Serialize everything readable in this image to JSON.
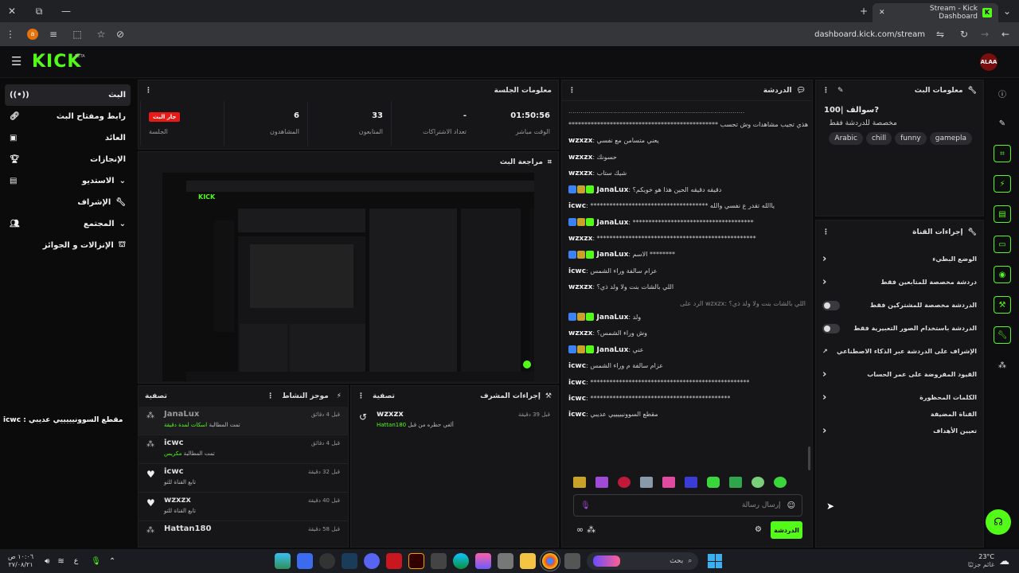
{
  "browser": {
    "tab_title": "Stream - Kick Dashboard",
    "url": "dashboard.kick.com/stream",
    "avatar_letter": "a"
  },
  "header": {
    "logo": "KICK",
    "logo_sup": "BETA",
    "user_initials": "ALAA"
  },
  "sidebar": {
    "items": [
      {
        "label": "البث",
        "icon": "broadcast-icon"
      },
      {
        "label": "رابط ومفتاح البث",
        "icon": "link-icon"
      },
      {
        "label": "العائد",
        "icon": "revenue-icon"
      },
      {
        "label": "الإنجازات",
        "icon": "trophy-icon"
      },
      {
        "label": "الاستديو",
        "icon": "studio-icon"
      },
      {
        "label": "الإشراف",
        "icon": "wrench-icon"
      },
      {
        "label": "المجتمع",
        "icon": "community-icon"
      },
      {
        "label": "الإنزالات و الجوائز",
        "icon": "drops-icon"
      }
    ]
  },
  "session": {
    "title": "معلومات الجلسة",
    "live_badge": "جار البث",
    "session_label": "الجلسة",
    "stats": [
      {
        "value": "6",
        "label": "المشاهدون"
      },
      {
        "value": "33",
        "label": "المتابعون"
      },
      {
        "value": "-",
        "label": "تعداد الاشتراكات"
      },
      {
        "value": "01:50:56",
        "label": "الوقت مباشر"
      }
    ]
  },
  "preview": {
    "title": "مراجعة البث",
    "overlay_caption": "icwc : مقطع السوونيييييي عديبي"
  },
  "activity": {
    "title": "موجز النشاط",
    "filter": "تصفية",
    "rows": [
      {
        "user": "JanaLux",
        "time": "قبل 4 دقائق",
        "text": "تمت المطالبة",
        "highlight": "اسكات لمدة دقيقة"
      },
      {
        "user": "icwc",
        "time": "قبل 4 دقائق",
        "text": "تمت المطالبة",
        "highlight": "مكريس"
      },
      {
        "user": "icwc",
        "time": "قبل 32 دقيقة",
        "text": "تابع القناة للتو",
        "highlight": ""
      },
      {
        "user": "wzxzx",
        "time": "قبل 40 دقيقة",
        "text": "تابع القناة للتو",
        "highlight": ""
      },
      {
        "user": "Hattan180",
        "time": "قبل 58 دقيقة",
        "text": "",
        "highlight": ""
      }
    ]
  },
  "mod": {
    "title": "إجراءات المشرف",
    "filter": "تصفية",
    "row": {
      "user": "wzxzx",
      "time": "قبل 39 دقيقة",
      "by": "Hattan180",
      "text": "ألغي حظره من قبل"
    }
  },
  "chat": {
    "title": "الدردشة",
    "messages": [
      {
        "user": "",
        "text": "*********************************************** هذي تجيب مشاهدات وش تحسب",
        "badges": 0
      },
      {
        "user": "wzxzx",
        "text": "يعني متسامن مع نفسي",
        "badges": 0
      },
      {
        "user": "wzxzx",
        "text": "حسونك",
        "badges": 0
      },
      {
        "user": "wzxzx",
        "text": "شيك ستاب",
        "badges": 0
      },
      {
        "user": "JanaLux",
        "text": "دقيقه دقيقه الحين هذا هو خويكم؟",
        "badges": 3
      },
      {
        "user": "icwc",
        "text": "************************************* ياالله تقدر ع نفسي والله",
        "badges": 0
      },
      {
        "user": "JanaLux",
        "text": "**************************************",
        "badges": 3
      },
      {
        "user": "wzxzx",
        "text": "**************************************************",
        "badges": 0
      },
      {
        "user": "JanaLux",
        "text": "الاسم ********",
        "badges": 3
      },
      {
        "user": "icwc",
        "text": "عزام سالفة وراء الشمس",
        "badges": 0
      },
      {
        "user": "wzxzx",
        "text": "اللي بالشات بنت ولا ولد ذي؟",
        "badges": 0
      },
      {
        "user": "JanaLux",
        "text": "ولد",
        "badges": 3
      },
      {
        "user": "wzxzx",
        "text": "وش وراء الشمس؟",
        "badges": 0
      },
      {
        "user": "JanaLux",
        "text": "عني",
        "badges": 3
      },
      {
        "user": "icwc",
        "text": "عزام سالفة م وراء الشمس",
        "badges": 0
      },
      {
        "user": "icwc",
        "text": "**************************************************",
        "badges": 0
      },
      {
        "user": "icwc",
        "text": "********************************************",
        "badges": 0
      },
      {
        "user": "icwc",
        "text": "مقطع السوونيييييي عديبي",
        "badges": 0
      }
    ],
    "reply_note": "الرد على wzxzx: اللي بالشات بنت ولا ولد ذي؟",
    "input_placeholder": "إرسال رسالة",
    "send_label": "الدردشة"
  },
  "stream_info": {
    "title": "معلومات البث",
    "stream_title": "سوالف |100?",
    "category": "مخصصة للدردشة فقط",
    "tags": [
      "Arabic",
      "chill",
      "funny",
      "gamepla"
    ]
  },
  "channel_actions": {
    "title": "إجراءات القناة",
    "rows": [
      {
        "label": "الوضع البطيء",
        "type": "chevron"
      },
      {
        "label": "دردشة مخصصة للمتابعين فقط",
        "type": "chevron"
      },
      {
        "label": "الدردشة مخصصة للمشتركين فقط",
        "type": "toggle"
      },
      {
        "label": "الدردشة باستخدام الصور التعبيرية فقط",
        "type": "toggle"
      },
      {
        "label": "الإشراف على الدردشة عبر الذكاء الاصطناعي",
        "type": "external"
      },
      {
        "label": "القيود المفروضة على عمر الحساب",
        "type": "chevron"
      },
      {
        "label": "الكلمات المحظورة",
        "type": "chevron"
      }
    ],
    "section_label": "القناة المضيفة",
    "goals_label": "تعيين الأهداف"
  },
  "taskbar": {
    "search": "بحث",
    "weather_temp": "23°C",
    "weather_text": "غائم جزئيًا",
    "time": "١٠:٠٦ ص",
    "date": "٢٧/٠٨/٢١",
    "lang": "ع"
  },
  "colors": {
    "accent": "#53fc18",
    "live": "#e91916"
  }
}
